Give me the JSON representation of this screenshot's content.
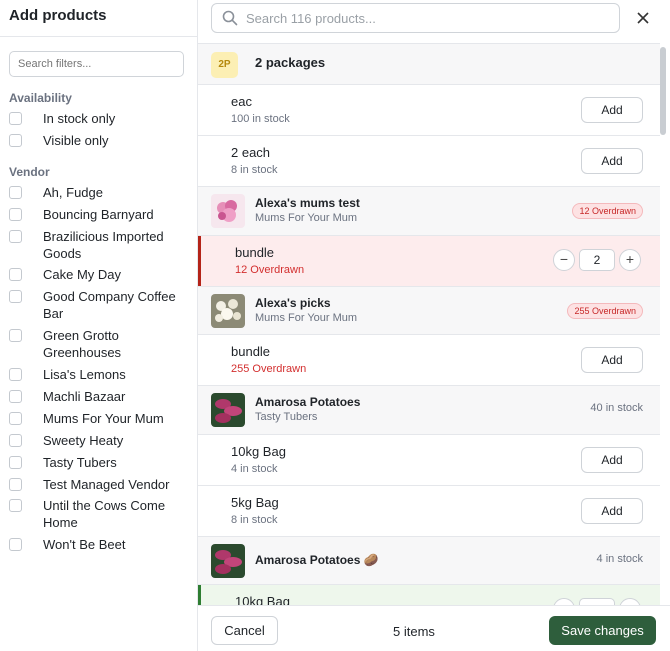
{
  "left": {
    "title": "Add products",
    "search_placeholder": "Search filters...",
    "availability": {
      "heading": "Availability",
      "options": [
        "In stock only",
        "Visible only"
      ]
    },
    "vendor": {
      "heading": "Vendor",
      "options": [
        "Ah, Fudge",
        "Bouncing Barnyard",
        "Brazilicious Imported Goods",
        "Cake My Day",
        "Good Company Coffee Bar",
        "Green Grotto Greenhouses",
        "Lisa's Lemons",
        "Machli Bazaar",
        "Mums For Your Mum",
        "Sweety Heaty",
        "Tasty Tubers",
        "Test Managed Vendor",
        "Until the Cows Come Home",
        "Won't Be Beet"
      ]
    }
  },
  "search": {
    "placeholder": "Search 116 products..."
  },
  "icons": {
    "search": "search-icon",
    "close": "close-icon",
    "minus": "minus-icon",
    "plus": "plus-icon",
    "potato_emoji": "🥔"
  },
  "list": {
    "packages": {
      "badge": "2P",
      "title": "2 packages"
    },
    "pkg_variants": [
      {
        "name": "eac",
        "sub": "100 in stock",
        "action": "Add"
      },
      {
        "name": "2 each",
        "sub": "8 in stock",
        "action": "Add"
      }
    ],
    "alexa_mums": {
      "name": "Alexa's mums test",
      "vendor": "Mums For Your Mum",
      "badge": "12 Overdrawn"
    },
    "alexa_mums_variant": {
      "name": "bundle",
      "sub": "12 Overdrawn",
      "qty": "2",
      "minus": "−",
      "plus": "+"
    },
    "alexa_picks": {
      "name": "Alexa's picks",
      "vendor": "Mums For Your Mum",
      "badge": "255 Overdrawn"
    },
    "alexa_picks_variant": {
      "name": "bundle",
      "sub": "255 Overdrawn",
      "action": "Add"
    },
    "amarosa1": {
      "name": "Amarosa Potatoes",
      "vendor": "Tasty Tubers",
      "stock": "40 in stock"
    },
    "amarosa1_variants": [
      {
        "name": "10kg Bag",
        "sub": "4 in stock",
        "action": "Add"
      },
      {
        "name": "5kg Bag",
        "sub": "8 in stock",
        "action": "Add"
      }
    ],
    "amarosa2": {
      "name": "Amarosa Potatoes",
      "stock": "4 in stock"
    },
    "amarosa2_variant": {
      "name": "10kg Bag"
    }
  },
  "footer": {
    "cancel": "Cancel",
    "count": "5 items",
    "save": "Save changes"
  },
  "colors": {
    "save_green": "#2e5e3c",
    "overdrawn_red": "#c62828",
    "pink_row": "#fdeced",
    "accent_red": "#b42318",
    "accent_green": "#2e7d32"
  }
}
